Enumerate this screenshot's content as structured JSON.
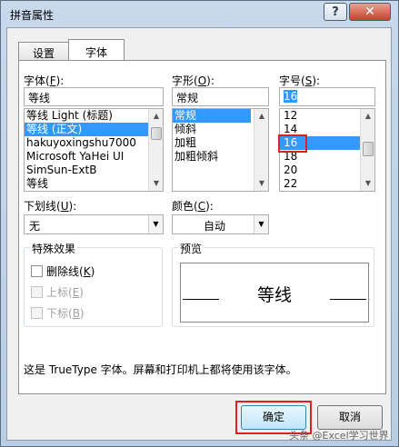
{
  "window": {
    "title": "拼音属性",
    "help_glyph": "?",
    "close_glyph": "✕"
  },
  "tabs": [
    {
      "label": "设置"
    },
    {
      "label": "字体"
    }
  ],
  "font": {
    "label_prefix": "字体(",
    "label_key": "F",
    "label_suffix": "):",
    "value": "等线",
    "items": [
      "等线 Light (标题)",
      "等线 (正文)",
      "hakuyoxingshu7000",
      "Microsoft YaHei UI",
      "SimSun-ExtB",
      "等线"
    ],
    "selected_index": 1
  },
  "style": {
    "label_prefix": "字形(",
    "label_key": "O",
    "label_suffix": "):",
    "value": "常规",
    "items": [
      "常规",
      "倾斜",
      "加粗",
      "加粗倾斜"
    ],
    "selected_index": 0
  },
  "size": {
    "label_prefix": "字号(",
    "label_key": "S",
    "label_suffix": "):",
    "value": "16",
    "items": [
      "12",
      "14",
      "16",
      "18",
      "20",
      "22"
    ],
    "selected_index": 2
  },
  "underline": {
    "label_prefix": "下划线(",
    "label_key": "U",
    "label_suffix": "):",
    "value": "无"
  },
  "color": {
    "label_prefix": "颜色(",
    "label_key": "C",
    "label_suffix": "):",
    "value": "自动"
  },
  "effects": {
    "title": "特殊效果",
    "strikethrough": {
      "label_prefix": "删除线(",
      "label_key": "K",
      "label_suffix": ")",
      "checked": false,
      "enabled": true
    },
    "superscript": {
      "label_prefix": "上标(",
      "label_key": "E",
      "label_suffix": ")",
      "checked": false,
      "enabled": false
    },
    "subscript": {
      "label_prefix": "下标(",
      "label_key": "B",
      "label_suffix": ")",
      "checked": false,
      "enabled": false
    }
  },
  "preview": {
    "title": "预览",
    "sample": "等线"
  },
  "description": "这是 TrueType 字体。屏幕和打印机上都将使用该字体。",
  "buttons": {
    "ok": "确定",
    "cancel": "取消"
  },
  "watermark": "头条 @Excel学习世界",
  "colors": {
    "selection": "#3399ff",
    "highlight": "#e02020",
    "titlebar": "#c8d9ec"
  }
}
